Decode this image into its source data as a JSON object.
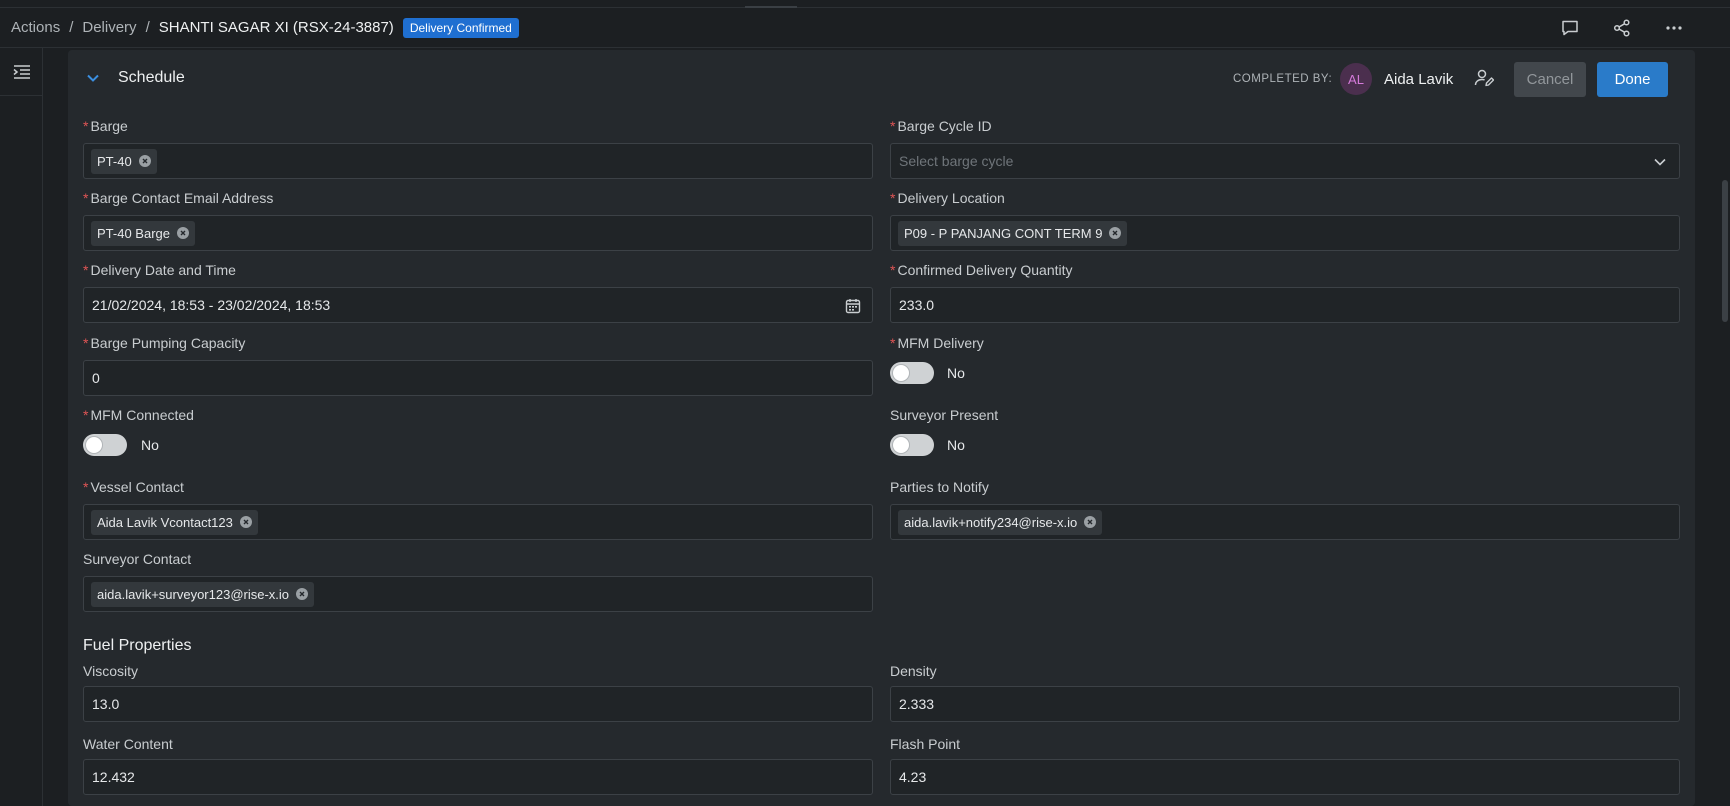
{
  "breadcrumb": {
    "items": [
      "Actions",
      "Delivery"
    ],
    "separator": "/",
    "current": "SHANTI SAGAR XI (RSX-24-3887)",
    "status_badge": "Delivery Confirmed"
  },
  "header_icons": [
    "comment-icon",
    "share-icon",
    "more-icon"
  ],
  "section": {
    "title": "Schedule",
    "completed_by_label": "COMPLETED BY:",
    "avatar_initials": "AL",
    "completed_by_name": "Aida Lavik",
    "cancel_label": "Cancel",
    "done_label": "Done"
  },
  "fields": {
    "barge": {
      "label": "Barge",
      "required": true,
      "tag": "PT-40"
    },
    "barge_cycle": {
      "label": "Barge Cycle ID",
      "required": true,
      "placeholder": "Select barge cycle"
    },
    "barge_email": {
      "label": "Barge Contact Email Address",
      "required": true,
      "tag": "PT-40 Barge"
    },
    "delivery_location": {
      "label": "Delivery Location",
      "required": true,
      "tag": "P09 - P PANJANG CONT TERM 9"
    },
    "delivery_datetime": {
      "label": "Delivery Date and Time",
      "required": true,
      "value": "21/02/2024, 18:53 - 23/02/2024, 18:53"
    },
    "confirmed_qty": {
      "label": "Confirmed Delivery Quantity",
      "required": true,
      "value": "233.0"
    },
    "pumping_capacity": {
      "label": "Barge Pumping Capacity",
      "required": true,
      "value": "0"
    },
    "mfm_delivery": {
      "label": "MFM Delivery",
      "required": true,
      "value": "No",
      "on": false
    },
    "mfm_connected": {
      "label": "MFM Connected",
      "required": true,
      "value": "No",
      "on": false
    },
    "surveyor_present": {
      "label": "Surveyor Present",
      "required": false,
      "value": "No",
      "on": false
    },
    "vessel_contact": {
      "label": "Vessel Contact",
      "required": true,
      "tag": "Aida Lavik Vcontact123"
    },
    "parties_notify": {
      "label": "Parties to Notify",
      "required": false,
      "tag": "aida.lavik+notify234@rise-x.io"
    },
    "surveyor_contact": {
      "label": "Surveyor Contact",
      "required": false,
      "tag": "aida.lavik+surveyor123@rise-x.io"
    }
  },
  "fuel": {
    "title": "Fuel Properties",
    "viscosity": {
      "label": "Viscosity",
      "value": "13.0"
    },
    "density": {
      "label": "Density",
      "value": "2.333"
    },
    "water_content": {
      "label": "Water Content",
      "value": "12.432"
    },
    "flash_point": {
      "label": "Flash Point",
      "value": "4.23"
    }
  },
  "colors": {
    "accent": "#2a7bc9",
    "badge": "#1f6fd1",
    "required": "#e05555",
    "panel": "#25292d",
    "background": "#1c1f22"
  }
}
